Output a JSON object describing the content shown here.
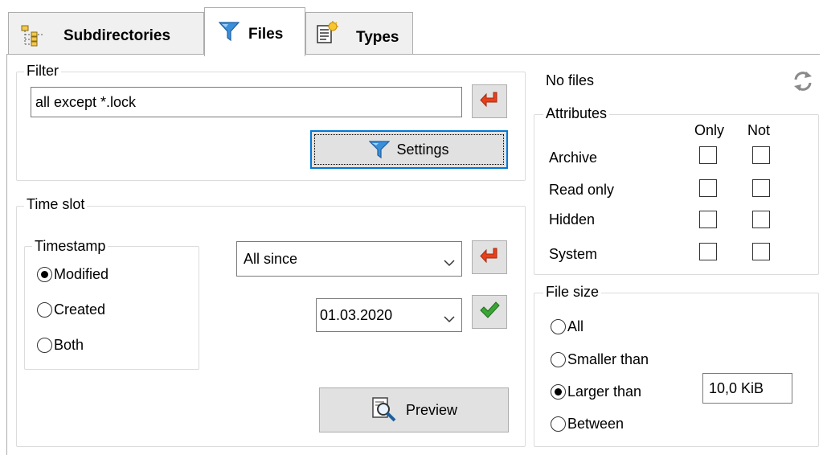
{
  "tabs": [
    {
      "label": "Subdirectories",
      "icon": "tree-icon"
    },
    {
      "label": "Files",
      "icon": "funnel-icon"
    },
    {
      "label": "Types",
      "icon": "document-types-icon"
    }
  ],
  "filter": {
    "title": "Filter",
    "value": "all except *.lock",
    "settings_label": "Settings"
  },
  "time_slot": {
    "title": "Time slot",
    "timestamp": {
      "title": "Timestamp",
      "options": [
        "Modified",
        "Created",
        "Both"
      ],
      "selected": "Modified"
    },
    "range_value": "All since",
    "date_value": "01.03.2020",
    "preview_label": "Preview"
  },
  "status_text": "No files",
  "attributes": {
    "title": "Attributes",
    "col_only": "Only",
    "col_not": "Not",
    "rows": [
      "Archive",
      "Read only",
      "Hidden",
      "System"
    ]
  },
  "file_size": {
    "title": "File size",
    "options": [
      "All",
      "Smaller than",
      "Larger than",
      "Between"
    ],
    "selected": "Larger than",
    "value": "10,0 KiB"
  },
  "colors": {
    "enter_arrow": "#e8401c",
    "check_green": "#3aa635",
    "funnel_blue": "#3b8fd9",
    "focus_blue": "#0078d7"
  }
}
